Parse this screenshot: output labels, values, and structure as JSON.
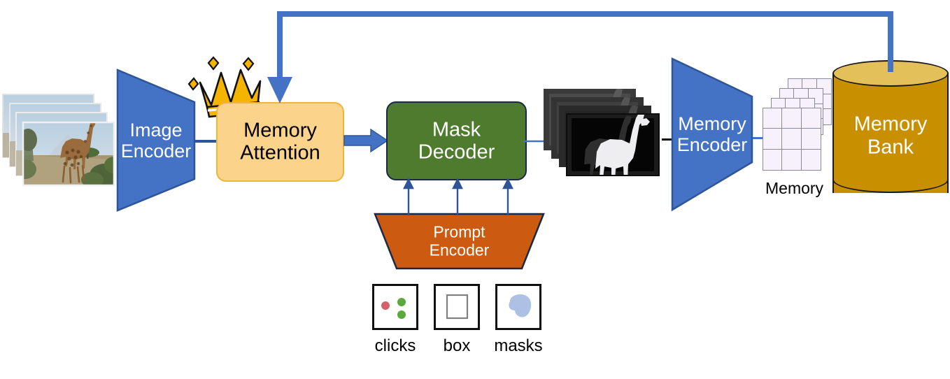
{
  "diagram": {
    "title": "SAM 2 model architecture",
    "background_color": "#ffffff"
  },
  "blocks": {
    "image_encoder": {
      "label": "Image\nEncoder",
      "shape": "trapezoid-right",
      "fill": "#4472C4",
      "stroke": "#2F5597",
      "text_color": "#ffffff"
    },
    "memory_attention": {
      "label": "Memory\nAttention",
      "shape": "rounded-rect",
      "fill": "#FBD38B",
      "stroke": "#F0B437",
      "text_color": "#000000",
      "badge": "crown-icon"
    },
    "mask_decoder": {
      "label": "Mask\nDecoder",
      "shape": "rounded-rect",
      "fill": "#4E7B2E",
      "stroke": "#1A2A44",
      "text_color": "#ffffff"
    },
    "prompt_encoder": {
      "label": "Prompt\nEncoder",
      "shape": "trapezoid-down",
      "fill": "#CC5A11",
      "stroke": "#1A2A44",
      "text_color": "#ffffff"
    },
    "memory_encoder": {
      "label": "Memory\nEncoder",
      "shape": "trapezoid-right",
      "fill": "#4472C4",
      "stroke": "#2F5597",
      "text_color": "#ffffff"
    },
    "memory_bank": {
      "label": "Memory\nBank",
      "shape": "cylinder",
      "fill": "#C89000",
      "top_fill": "#E3C05A",
      "stroke": "#1a1a1a",
      "text_color": "#ffffff"
    }
  },
  "labels": {
    "memory": "Memory",
    "clicks": "clicks",
    "box": "box",
    "masks": "masks"
  },
  "prompt_icons": [
    {
      "name": "clicks-icon",
      "caption": "clicks",
      "dots": [
        {
          "color": "#D4626A",
          "kind": "negative"
        },
        {
          "color": "#5BA83C",
          "kind": "positive"
        },
        {
          "color": "#5BA83C",
          "kind": "positive"
        }
      ]
    },
    {
      "name": "box-icon",
      "caption": "box",
      "stroke": "#808080"
    },
    {
      "name": "masks-icon",
      "caption": "masks",
      "fill": "#AFC0E5"
    }
  ],
  "media": {
    "input_frames_count": 4,
    "input_description": "giraffe in savanna video frames",
    "output_frames_count": 4,
    "output_description": "black-and-white giraffe segmentation masks",
    "memory_sheets_count": 4,
    "memory_sheet_grid": "3x3"
  },
  "connections": [
    {
      "name": "image-encoder-to-memory-attention",
      "style": "line",
      "color": "#4472C4"
    },
    {
      "name": "memory-attention-to-mask-decoder",
      "style": "block-arrow",
      "color": "#4472C4"
    },
    {
      "name": "mask-decoder-to-output-masks",
      "style": "thin-arrow",
      "color": "#4472C4"
    },
    {
      "name": "prompt-encoder-to-mask-decoder-1",
      "style": "thin-arrow",
      "color": "#2F5597"
    },
    {
      "name": "prompt-encoder-to-mask-decoder-2",
      "style": "thin-arrow",
      "color": "#2F5597"
    },
    {
      "name": "prompt-encoder-to-mask-decoder-3",
      "style": "thin-arrow",
      "color": "#2F5597"
    },
    {
      "name": "output-masks-to-memory-encoder",
      "style": "thin-line",
      "color": "#111111"
    },
    {
      "name": "memory-encoder-to-memory-grids",
      "style": "thin-line",
      "color": "#4472C4"
    },
    {
      "name": "memory-bank-feedback-to-memory-attention",
      "style": "thick-arrow",
      "color": "#4472C4"
    }
  ]
}
